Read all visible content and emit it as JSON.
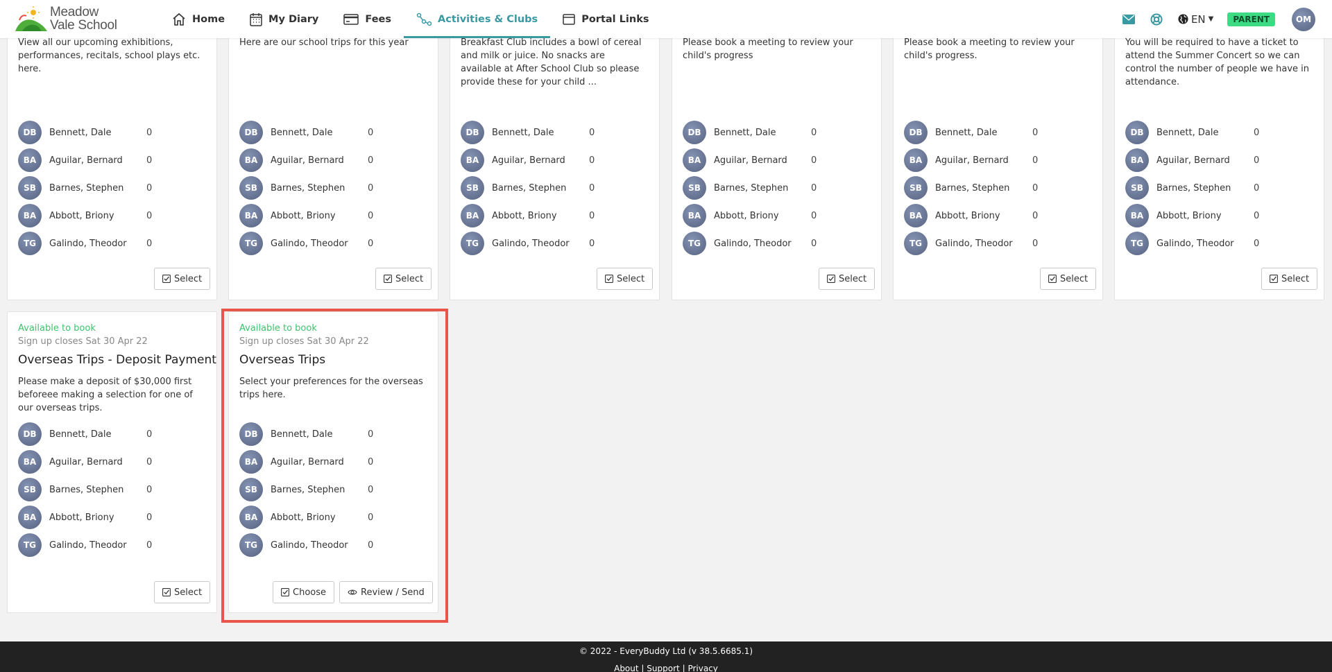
{
  "header": {
    "logo_line1": "Meadow",
    "logo_line2": "Vale School",
    "nav": [
      {
        "label": "Home",
        "icon": "home-icon"
      },
      {
        "label": "My Diary",
        "icon": "calendar-icon"
      },
      {
        "label": "Fees",
        "icon": "credit-card-icon"
      },
      {
        "label": "Activities & Clubs",
        "icon": "activities-icon"
      },
      {
        "label": "Portal Links",
        "icon": "window-icon"
      }
    ],
    "language": "EN",
    "role_badge": "PARENT",
    "user_initials": "OM"
  },
  "colors": {
    "accent": "#3a9aa3",
    "available": "#3cc46b",
    "highlight": "#e8554b",
    "badge": "#3ddc84"
  },
  "students": [
    {
      "initials": "DB",
      "name": "Bennett, Dale",
      "count": "0"
    },
    {
      "initials": "BA",
      "name": "Aguilar, Bernard",
      "count": "0"
    },
    {
      "initials": "SB",
      "name": "Barnes, Stephen",
      "count": "0"
    },
    {
      "initials": "BA",
      "name": "Abbott, Briony",
      "count": "0"
    },
    {
      "initials": "TG",
      "name": "Galindo, Theodor",
      "count": "0"
    }
  ],
  "top_cards": [
    {
      "desc": "View all our upcoming exhibitions, performances, recitals, school plays etc. here.",
      "select_label": "Select"
    },
    {
      "desc": "Here are our school trips for this year",
      "select_label": "Select"
    },
    {
      "desc": "Breakfast Club includes a bowl of cereal and milk or juice.  No snacks are available at After School Club so please provide these for your child ...",
      "select_label": "Select"
    },
    {
      "desc": "Please book a meeting to review your child's progress",
      "select_label": "Select"
    },
    {
      "desc": "Please book a meeting to review your child's progress.",
      "select_label": "Select"
    },
    {
      "desc": "You will be required to have a ticket to attend the Summer Concert so we can control the number of people we have in attendance.",
      "select_label": "Select"
    }
  ],
  "bottom_cards": [
    {
      "status": "Available to book",
      "closes": "Sign up closes Sat 30 Apr 22",
      "title": "Overseas Trips - Deposit Payment",
      "desc": "Please make a deposit of $30,000 first beforeee making a selection for one of our overseas trips.",
      "select_label": "Select"
    },
    {
      "status": "Available to book",
      "closes": "Sign up closes Sat 30 Apr 22",
      "title": "Overseas Trips",
      "desc": "Select your preferences for the overseas trips here.",
      "choose_label": "Choose",
      "review_label": "Review / Send"
    }
  ],
  "footer": {
    "copyright": "© 2022 - EveryBuddy Ltd (v 38.5.6685.1)",
    "about": "About",
    "support": "Support",
    "privacy": "Privacy",
    "separator": "|"
  }
}
